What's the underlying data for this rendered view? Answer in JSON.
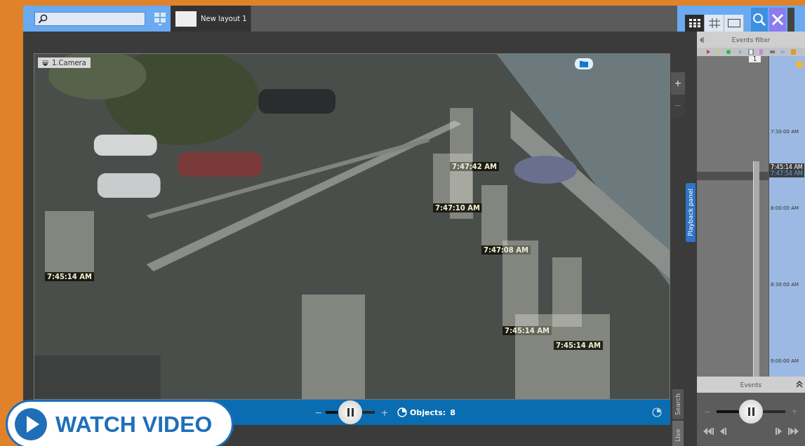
{
  "toolbar": {
    "layout_tab": "New layout 1",
    "view_buttons": [
      {
        "selected": true
      },
      {
        "selected": false
      },
      {
        "selected": false
      }
    ]
  },
  "camera": {
    "title": "1.Camera",
    "detections": [
      {
        "kind": "labeled",
        "time": "7:47:42 AM"
      },
      {
        "kind": "labeled",
        "time": "7:47:10 AM"
      },
      {
        "kind": "labeled",
        "time": "7:47:08 AM"
      },
      {
        "kind": "labeled",
        "time": "7:45:14 AM"
      },
      {
        "kind": "plain"
      },
      {
        "kind": "labeled",
        "time": "7:45:14 AM"
      },
      {
        "kind": "labeled",
        "time": "7:45:14 AM"
      },
      {
        "kind": "plain"
      }
    ],
    "zoom": {
      "plus": "+",
      "minus": "−"
    },
    "playback": {
      "minus": "−",
      "plus": "+",
      "level": 0.5,
      "objects_label": "Objects:",
      "objects_count": "8"
    }
  },
  "side_tabs": {
    "playback_panel": "Playback panel",
    "search": "Search",
    "live": "Live"
  },
  "events_panel": {
    "title": "Events filter",
    "badge": "1",
    "ticks": [
      "7:30:00 AM",
      "8:00:00 AM",
      "8:30:00 AM",
      "9:00:00 AM"
    ],
    "current_time": "7:45:14 AM",
    "end_time": "7:47:54 AM",
    "events_title": "Events",
    "minus": "−",
    "plus": "+",
    "level": 0.5
  },
  "watch_video": {
    "label": "WATCH VIDEO"
  }
}
